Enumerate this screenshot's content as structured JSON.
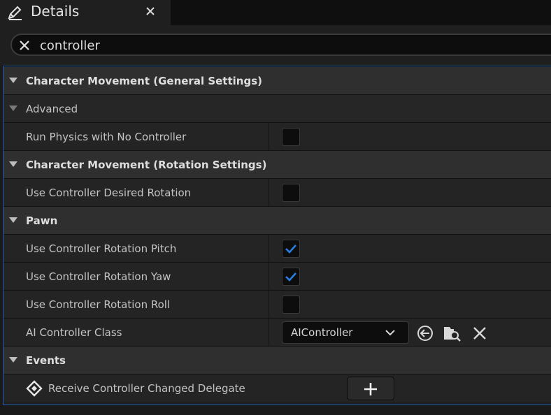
{
  "tab": {
    "title": "Details",
    "icon": "pencil-icon",
    "close_icon": "close-icon"
  },
  "search": {
    "value": "controller",
    "clear_icon": "close-icon"
  },
  "colors": {
    "accent": "#1c6fd6",
    "panel_border": "#1c5fb0",
    "checkmark": "#2a7fe0"
  },
  "sections": {
    "general": {
      "title": "Character Movement (General Settings)",
      "advanced": "Advanced",
      "run_physics": {
        "label": "Run Physics with No Controller",
        "checked": false
      }
    },
    "rotation": {
      "title": "Character Movement (Rotation Settings)",
      "desired_rotation": {
        "label": "Use Controller Desired Rotation",
        "checked": false
      }
    },
    "pawn": {
      "title": "Pawn",
      "pitch": {
        "label": "Use Controller Rotation Pitch",
        "checked": true
      },
      "yaw": {
        "label": "Use Controller Rotation Yaw",
        "checked": true
      },
      "roll": {
        "label": "Use Controller Rotation Roll",
        "checked": false
      },
      "ai_class": {
        "label": "AI Controller Class",
        "value": "AIController",
        "icons": [
          "use-selected-arrow-icon",
          "browse-folder-icon",
          "clear-icon"
        ]
      }
    },
    "events": {
      "title": "Events",
      "receive_changed": {
        "label": "Receive Controller Changed Delegate",
        "icon": "event-diamond-icon",
        "button_icon": "plus-icon"
      }
    }
  }
}
